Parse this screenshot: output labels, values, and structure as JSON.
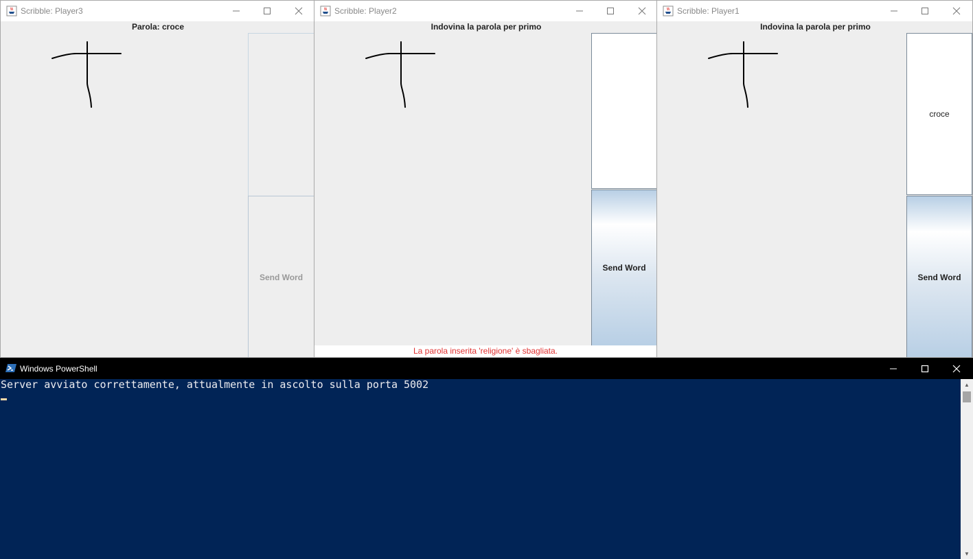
{
  "windows": [
    {
      "title": "Scribble: Player3",
      "header": "Parola: croce",
      "word_text": "",
      "button_label": "Send Word",
      "button_enabled": false,
      "status": ""
    },
    {
      "title": "Scribble: Player2",
      "header": "Indovina la parola per primo",
      "word_text": "",
      "button_label": "Send Word",
      "button_enabled": true,
      "status": "La parola inserita 'religione' è sbagliata."
    },
    {
      "title": "Scribble: Player1",
      "header": "Indovina la parola per primo",
      "word_text": "croce",
      "button_label": "Send Word",
      "button_enabled": true,
      "status": ""
    }
  ],
  "powershell": {
    "title": "Windows PowerShell",
    "output": "Server avviato correttamente, attualmente in ascolto sulla porta 5002"
  },
  "colors": {
    "window_bg": "#eeeeee",
    "status_error": "#e03030",
    "powershell_bg": "#012456",
    "button_gradient": "#b8cfe5"
  },
  "icons": {
    "app": "java-cup-icon",
    "minimize": "minimize-icon",
    "maximize": "maximize-icon",
    "close": "close-icon",
    "powershell": "powershell-icon"
  }
}
